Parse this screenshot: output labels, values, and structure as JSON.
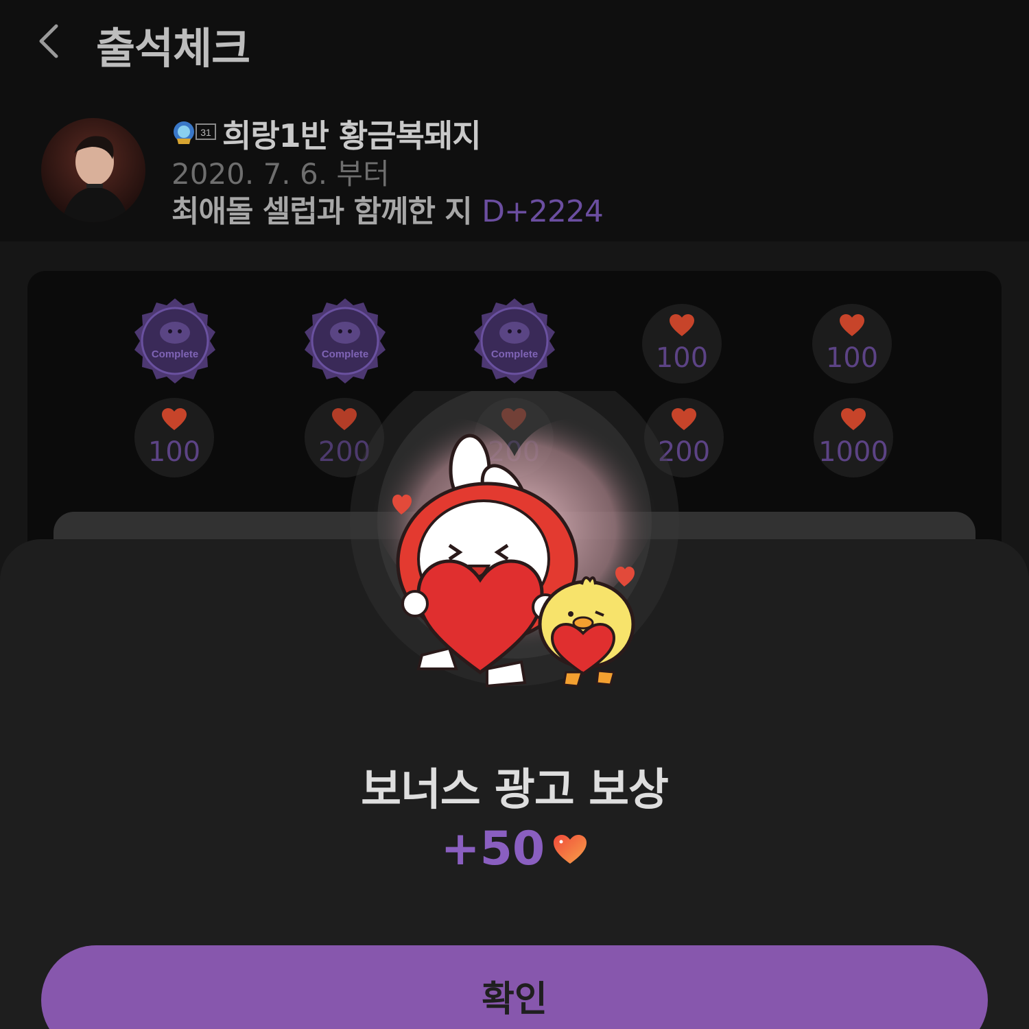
{
  "header": {
    "title": "출석체크"
  },
  "profile": {
    "badge_level": "31",
    "nickname": "희랑1반 황금복돼지",
    "since": "2020. 7. 6. 부터",
    "dday_prefix": "최애돌 셀럽과 함께한 지",
    "dday_value": "D+2224"
  },
  "attendance": {
    "row1": [
      {
        "type": "complete",
        "label": "Complete"
      },
      {
        "type": "complete",
        "label": "Complete"
      },
      {
        "type": "complete",
        "label": "Complete"
      },
      {
        "type": "heart",
        "amount": "100"
      },
      {
        "type": "heart",
        "amount": "100"
      }
    ],
    "row2": [
      {
        "type": "heart",
        "amount": "100"
      },
      {
        "type": "heart",
        "amount": "200"
      },
      {
        "type": "heart",
        "amount": "200"
      },
      {
        "type": "heart",
        "amount": "200"
      },
      {
        "type": "heart",
        "amount": "1000"
      }
    ]
  },
  "reward": {
    "title": "보너스 광고 보상",
    "amount": "+50"
  },
  "confirm_button": {
    "label": "확인"
  },
  "colors": {
    "accent": "#8757ad",
    "heart": "#e5462d"
  }
}
